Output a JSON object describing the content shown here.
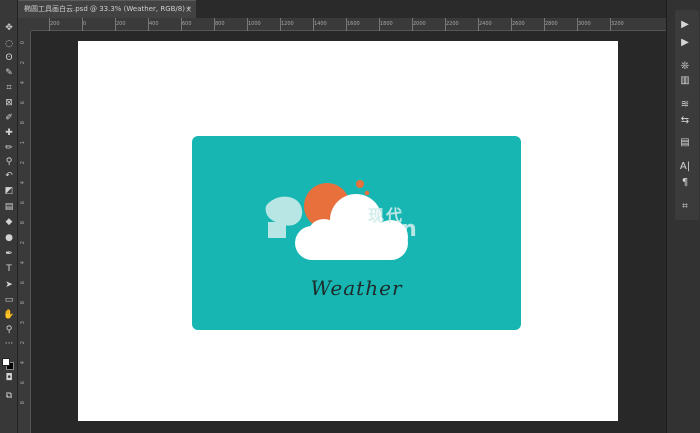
{
  "document_tab": {
    "title": "椭圆工具画白云.psd @ 33.3% (Weather, RGB/8) *",
    "close_glyph": "×"
  },
  "ruler_top": [
    "200",
    "0",
    "200",
    "400",
    "600",
    "800",
    "1000",
    "1200",
    "1400",
    "1600",
    "1800",
    "2000",
    "2200",
    "2400",
    "2600",
    "2800",
    "3000",
    "3200"
  ],
  "ruler_left": [
    "0",
    "2",
    "4",
    "6",
    "8",
    "1",
    "2",
    "4",
    "6",
    "8",
    "2",
    "4",
    "6",
    "8",
    "3",
    "2",
    "4",
    "6",
    "8"
  ],
  "toolbar_tools": [
    {
      "name": "move-tool-icon",
      "glyph": "✥"
    },
    {
      "name": "marquee-tool-icon",
      "glyph": "◌"
    },
    {
      "name": "lasso-tool-icon",
      "glyph": "ʘ"
    },
    {
      "name": "quick-select-tool-icon",
      "glyph": "✎"
    },
    {
      "name": "crop-tool-icon",
      "glyph": "⌗"
    },
    {
      "name": "frame-tool-icon",
      "glyph": "⊠"
    },
    {
      "name": "eyedropper-tool-icon",
      "glyph": "✐"
    },
    {
      "name": "healing-brush-icon",
      "glyph": "✚"
    },
    {
      "name": "brush-tool-icon",
      "glyph": "✏"
    },
    {
      "name": "clone-stamp-icon",
      "glyph": "⚲"
    },
    {
      "name": "history-brush-icon",
      "glyph": "↶"
    },
    {
      "name": "eraser-tool-icon",
      "glyph": "◩"
    },
    {
      "name": "gradient-tool-icon",
      "glyph": "▤"
    },
    {
      "name": "blur-tool-icon",
      "glyph": "◆"
    },
    {
      "name": "dodge-tool-icon",
      "glyph": "●"
    },
    {
      "name": "pen-tool-icon",
      "glyph": "✒"
    },
    {
      "name": "type-tool-icon",
      "glyph": "T"
    },
    {
      "name": "path-select-icon",
      "glyph": "➤"
    },
    {
      "name": "shape-tool-icon",
      "glyph": "▭"
    },
    {
      "name": "hand-tool-icon",
      "glyph": "✋"
    },
    {
      "name": "zoom-tool-icon",
      "glyph": "⚲"
    },
    {
      "name": "more-tools-icon",
      "glyph": "···"
    },
    {
      "name": "quick-mask-icon",
      "glyph": "◘"
    },
    {
      "name": "screen-mode-icon",
      "glyph": "⧉"
    }
  ],
  "card": {
    "label": "Weather",
    "watermark_cn": "现代",
    "colors": {
      "card": "#17b6b2",
      "sun": "#e8703d",
      "cloud": "#ffffff"
    }
  },
  "right_panel_icons": [
    {
      "name": "play-icon",
      "glyph": "▶"
    },
    {
      "name": "actions-icon",
      "glyph": "▶"
    },
    {
      "name": "brush-settings-icon",
      "glyph": "❊"
    },
    {
      "name": "brushes-icon",
      "glyph": "▥"
    },
    {
      "name": "adjustments-icon",
      "glyph": "≋"
    },
    {
      "name": "properties-icon",
      "glyph": "⇆"
    },
    {
      "name": "swatches-icon",
      "glyph": "▤"
    },
    {
      "name": "character-icon",
      "glyph": "A|"
    },
    {
      "name": "paragraph-icon",
      "glyph": "¶"
    },
    {
      "name": "crop-panel-icon",
      "glyph": "⌗"
    }
  ]
}
